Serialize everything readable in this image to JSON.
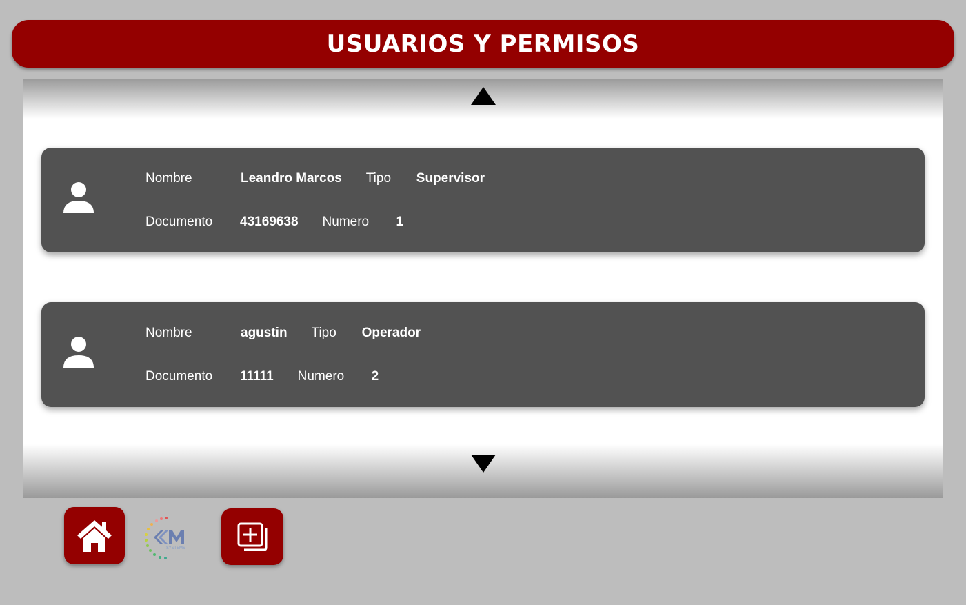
{
  "header": {
    "title": "USUARIOS Y PERMISOS"
  },
  "list": {
    "scroll_up_icon": "triangle-up",
    "scroll_down_icon": "triangle-down",
    "users": [
      {
        "name_label": "Nombre",
        "name": "Leandro Marcos",
        "type_label": "Tipo",
        "type": "Supervisor",
        "document_label": "Documento",
        "document": "43169638",
        "number_label": "Numero",
        "number": "1"
      },
      {
        "name_label": "Nombre",
        "name": "agustin",
        "type_label": "Tipo",
        "type": "Operador",
        "document_label": "Documento",
        "document": "11111",
        "number_label": "Numero",
        "number": "2"
      }
    ]
  },
  "toolbar": {
    "home_icon": "home-icon",
    "add_icon": "add-copy-icon",
    "logo_text": "SYSTEMS"
  },
  "colors": {
    "accent": "#940000",
    "card": "#525252",
    "background": "#bdbdbd"
  }
}
